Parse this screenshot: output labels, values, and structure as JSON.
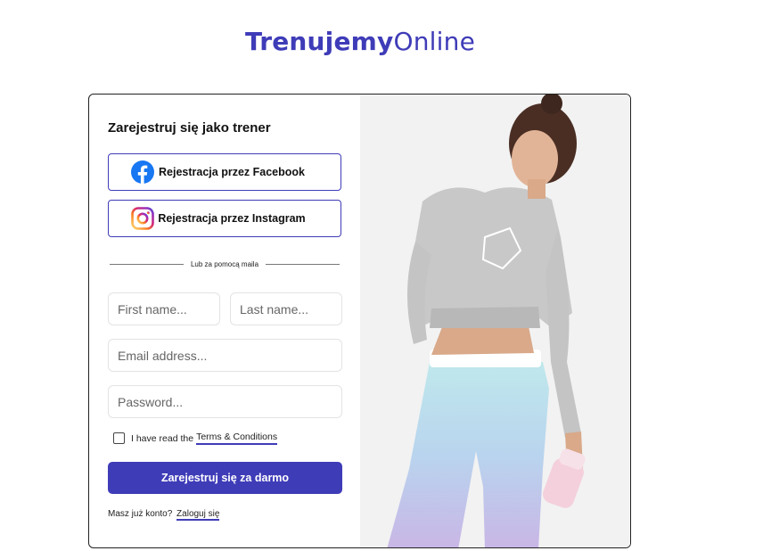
{
  "brand": {
    "bold": "Trenujemy",
    "light": "Online",
    "color": "#3f3cb8"
  },
  "form": {
    "title": "Zarejestruj się jako trener",
    "facebook_label": "Rejestracja przez Facebook",
    "instagram_label": "Rejestracja przez Instagram",
    "divider_text": "Lub za pomocą maila",
    "first_name_placeholder": "First name...",
    "last_name_placeholder": "Last name...",
    "email_placeholder": "Email address...",
    "password_placeholder": "Password...",
    "terms_prefix": "I have read the",
    "terms_link": "Terms & Conditions",
    "submit_label": "Zarejestruj się za darmo",
    "login_prefix": "Masz już konto?",
    "login_link": "Zaloguj się"
  },
  "icons": {
    "facebook": "facebook-icon",
    "instagram": "instagram-icon"
  },
  "colors": {
    "accent": "#3f3cb8",
    "facebook": "#1877f2"
  }
}
